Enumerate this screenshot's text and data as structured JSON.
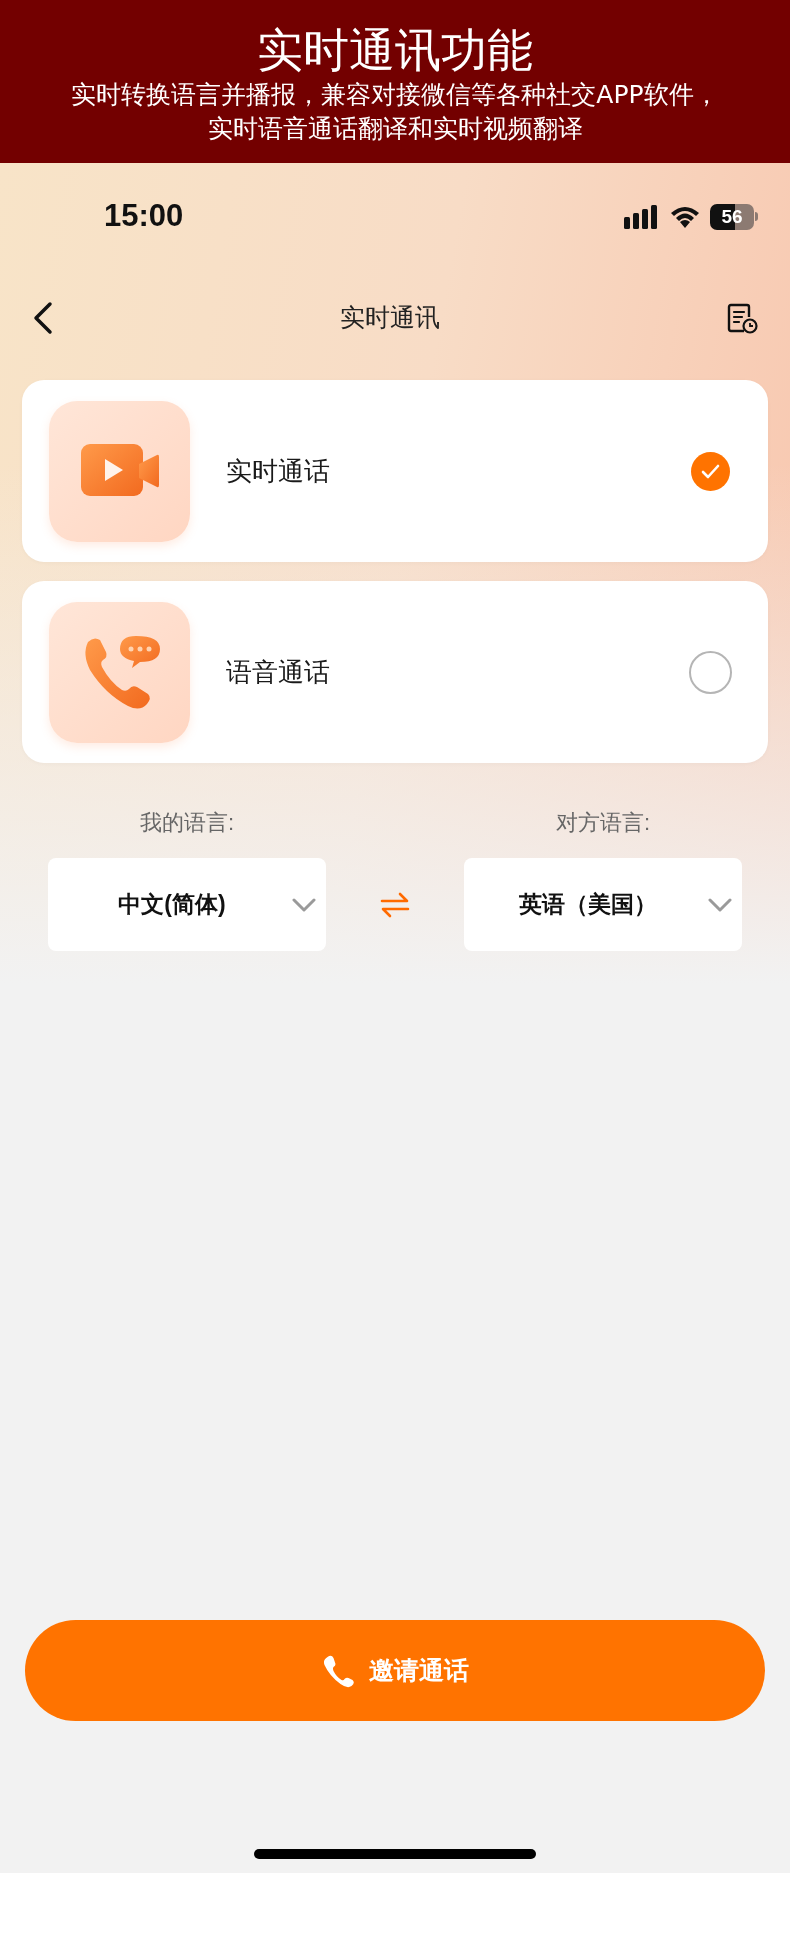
{
  "banner": {
    "title": "实时通讯功能",
    "subtitle_lines": [
      "实时转换语言并播报，兼容对接微信等各种社交APP软件，",
      "实时语音通话翻译和实时视频翻译"
    ]
  },
  "status_bar": {
    "time": "15:00",
    "battery": "56"
  },
  "nav": {
    "title": "实时通讯"
  },
  "call_types": [
    {
      "kind": "video",
      "label": "实时通话",
      "selected": true
    },
    {
      "kind": "voice",
      "label": "语音通话",
      "selected": false
    }
  ],
  "languages": {
    "mine": {
      "label": "我的语言:",
      "value": "中文(简体)"
    },
    "other": {
      "label": "对方语言:",
      "value": "英语（美国）"
    }
  },
  "invite_button": {
    "label": "邀请通话"
  }
}
